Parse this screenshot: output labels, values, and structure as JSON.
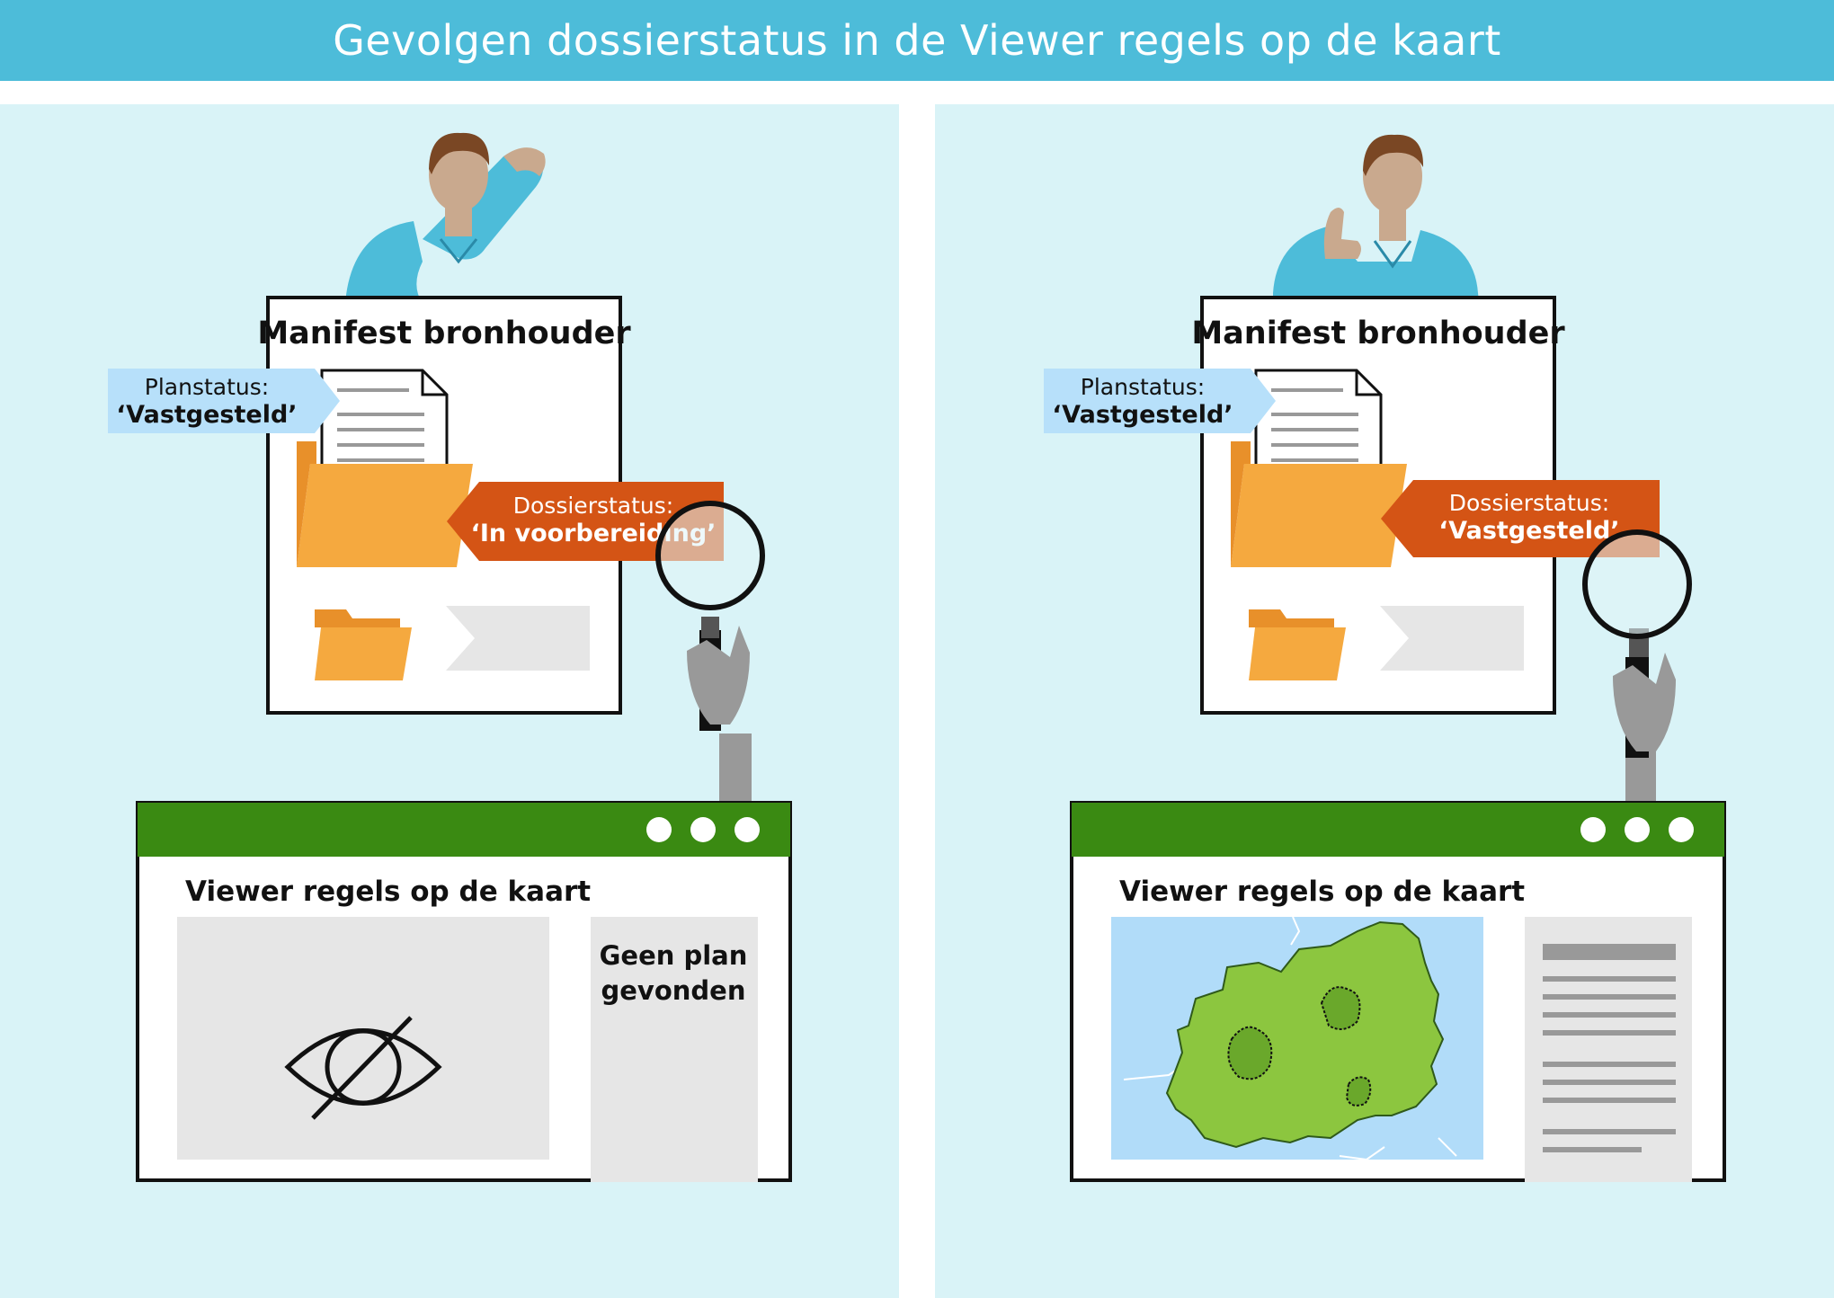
{
  "title": "Gevolgen dossierstatus in de Viewer regels op de kaart",
  "colors": {
    "header": "#4dbcd9",
    "panel": "#d9f3f7",
    "shirt": "#4dbcd9",
    "skin": "#c9a98e",
    "hair": "#7a4724",
    "folder": "#f5a93f",
    "folder_dark": "#e8902a",
    "planstatus_tag": "#b7e0fa",
    "dossier_tag": "#d45415",
    "viewer_bar": "#3a8a12",
    "map_water": "#b1dcf9",
    "map_land": "#8cc63f",
    "gray_box": "#e6e6e6"
  },
  "left": {
    "manifest_title": "Manifest bronhouder",
    "planstatus_label": "Planstatus:",
    "planstatus_value": "‘Vastgesteld’",
    "dossierstatus_label": "Dossierstatus:",
    "dossierstatus_value": "‘In voorbereiding’",
    "viewer_title": "Viewer regels op de kaart",
    "no_plan_line1": "Geen plan",
    "no_plan_line2": "gevonden",
    "map_icon": "eye-slash-icon"
  },
  "right": {
    "manifest_title": "Manifest bronhouder",
    "planstatus_label": "Planstatus:",
    "planstatus_value": "‘Vastgesteld’",
    "dossierstatus_label": "Dossierstatus:",
    "dossierstatus_value": "‘Vastgesteld’",
    "viewer_title": "Viewer regels op de kaart",
    "map_icon": "municipality-map-icon"
  }
}
